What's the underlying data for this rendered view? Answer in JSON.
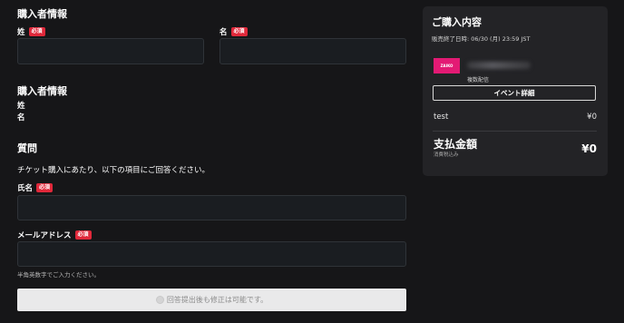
{
  "form": {
    "buyer_heading": "購入者情報",
    "last_name_label": "姓",
    "first_name_label": "名",
    "required_badge": "必須",
    "last_name_value": "",
    "first_name_value": "",
    "buyer_summary_heading": "購入者情報",
    "summary_last_name": "姓",
    "summary_first_name": "名",
    "question_heading": "質問",
    "question_intro": "チケット購入にあたり、以下の項目にご回答ください。",
    "full_name_label": "氏名",
    "full_name_value": "",
    "email_label": "メールアドレス",
    "email_value": "",
    "email_hint": "半角英数字でご入力ください。",
    "submit_note": "回答提出後も修正は可能です。"
  },
  "summary": {
    "title": "ご購入内容",
    "sale_end": "販売終了日時: 06/30 (月) 23:59 JST",
    "thumb_text": "ZAIKO",
    "distribution": "複数配信",
    "event_detail_button": "イベント詳細",
    "item_name": "test",
    "item_price": "¥0",
    "total_label": "支払金額",
    "tax_note": "消費税込み",
    "total_price": "¥0"
  },
  "colors": {
    "background": "#161618",
    "panel": "#232326",
    "required_badge": "#e0283a",
    "thumb": "#e31a74"
  }
}
